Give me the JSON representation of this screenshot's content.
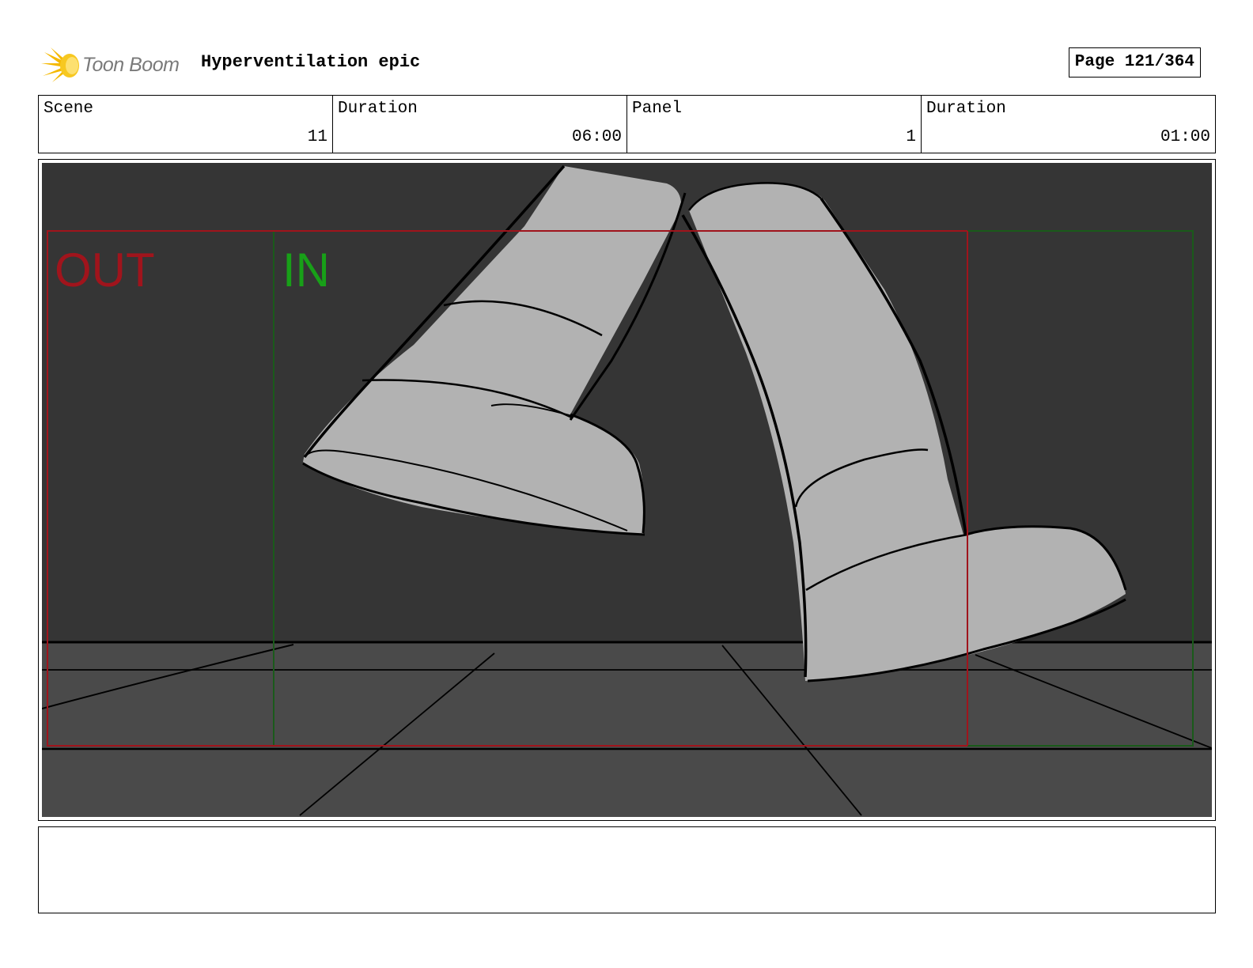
{
  "header": {
    "logo_text": "Toon Boom",
    "title": "Hyperventilation epic",
    "page_label": "Page 121/364"
  },
  "info": {
    "scene_label": "Scene",
    "scene_value": "11",
    "scene_duration_label": "Duration",
    "scene_duration_value": "06:00",
    "panel_label": "Panel",
    "panel_value": "1",
    "panel_duration_label": "Duration",
    "panel_duration_value": "01:00"
  },
  "frame": {
    "out_label": "OUT",
    "in_label": "IN",
    "out_color": "#a0141c",
    "in_color": "#18a018",
    "background_color": "#353535",
    "floor_color": "#4a4a4a",
    "boot_color": "#b2b2b2"
  },
  "notes": {
    "text": ""
  }
}
